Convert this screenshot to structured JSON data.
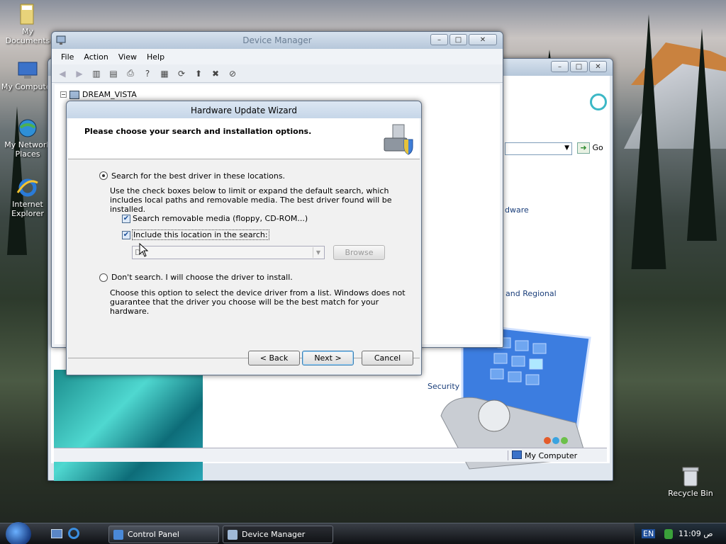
{
  "desktop": {
    "icons": [
      {
        "label": "My Documents"
      },
      {
        "label": "My Computer"
      },
      {
        "label": "My Network Places"
      },
      {
        "label": "Internet Explorer"
      },
      {
        "label": "Recycle Bin"
      }
    ]
  },
  "control_panel": {
    "go_label": "Go",
    "partial_texts": [
      "dware",
      "and Regional",
      "Security Center"
    ],
    "status_text": "My Computer"
  },
  "device_manager": {
    "title": "Device Manager",
    "menu": [
      "File",
      "Action",
      "View",
      "Help"
    ],
    "tree_root": "DREAM_VISTA"
  },
  "wizard": {
    "title": "Hardware Update Wizard",
    "header": "Please choose your search and installation options.",
    "option_search_label": "Search for the best driver in these locations.",
    "option_search_desc": "Use the check boxes below to limit or expand the default search, which includes local paths and removable media. The best driver found will be installed.",
    "check_removable_label": "Search removable media (floppy, CD-ROM...)",
    "check_removable_checked": true,
    "check_location_label": "Include this location in the search:",
    "check_location_checked": true,
    "location_value": "D:\\",
    "browse_label": "Browse",
    "option_dont_search_label": "Don't search. I will choose the driver to install.",
    "option_dont_search_desc": "Choose this option to select the device driver from a list.  Windows does not guarantee that the driver you choose will be the best match for your hardware.",
    "selected_option": "search",
    "back_label": "< Back",
    "next_label": "Next >",
    "cancel_label": "Cancel"
  },
  "taskbar": {
    "tasks": [
      {
        "label": "Control Panel"
      },
      {
        "label": "Device Manager"
      }
    ],
    "language": "EN",
    "clock": "11:09 ص"
  }
}
